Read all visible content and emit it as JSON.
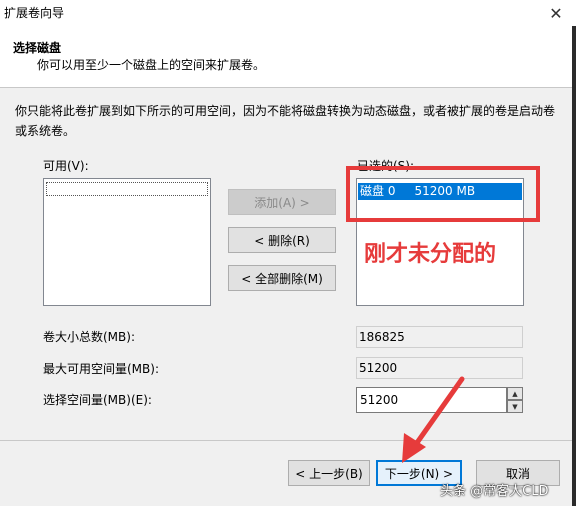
{
  "window": {
    "title": "扩展卷向导",
    "close_glyph": "✕"
  },
  "header": {
    "title": "选择磁盘",
    "subtitle": "你可以用至少一个磁盘上的空间来扩展卷。"
  },
  "description": "你只能将此卷扩展到如下所示的可用空间，因为不能将磁盘转换为动态磁盘，或者被扩展的卷是启动卷或系统卷。",
  "available": {
    "label": "可用(V):",
    "items": []
  },
  "selected": {
    "label": "已选的(S):",
    "items": [
      {
        "text": "磁盘 0     51200 MB"
      }
    ]
  },
  "buttons": {
    "add": "添加(A) >",
    "remove": "< 删除(R)",
    "remove_all": "< 全部删除(M)",
    "back": "< 上一步(B)",
    "next": "下一步(N) >",
    "cancel": "取消"
  },
  "fields": {
    "total_label": "卷大小总数(MB):",
    "total_value": "186825",
    "max_label": "最大可用空间量(MB):",
    "max_value": "51200",
    "choose_label": "选择空间量(MB)(E):",
    "choose_value": "51200"
  },
  "annotation": {
    "text": "刚才未分配的",
    "color": "#e63b3b"
  },
  "watermark": "头条 @常客大CLD",
  "colors": {
    "selection": "#0078d7",
    "annotation": "#e63b3b"
  }
}
